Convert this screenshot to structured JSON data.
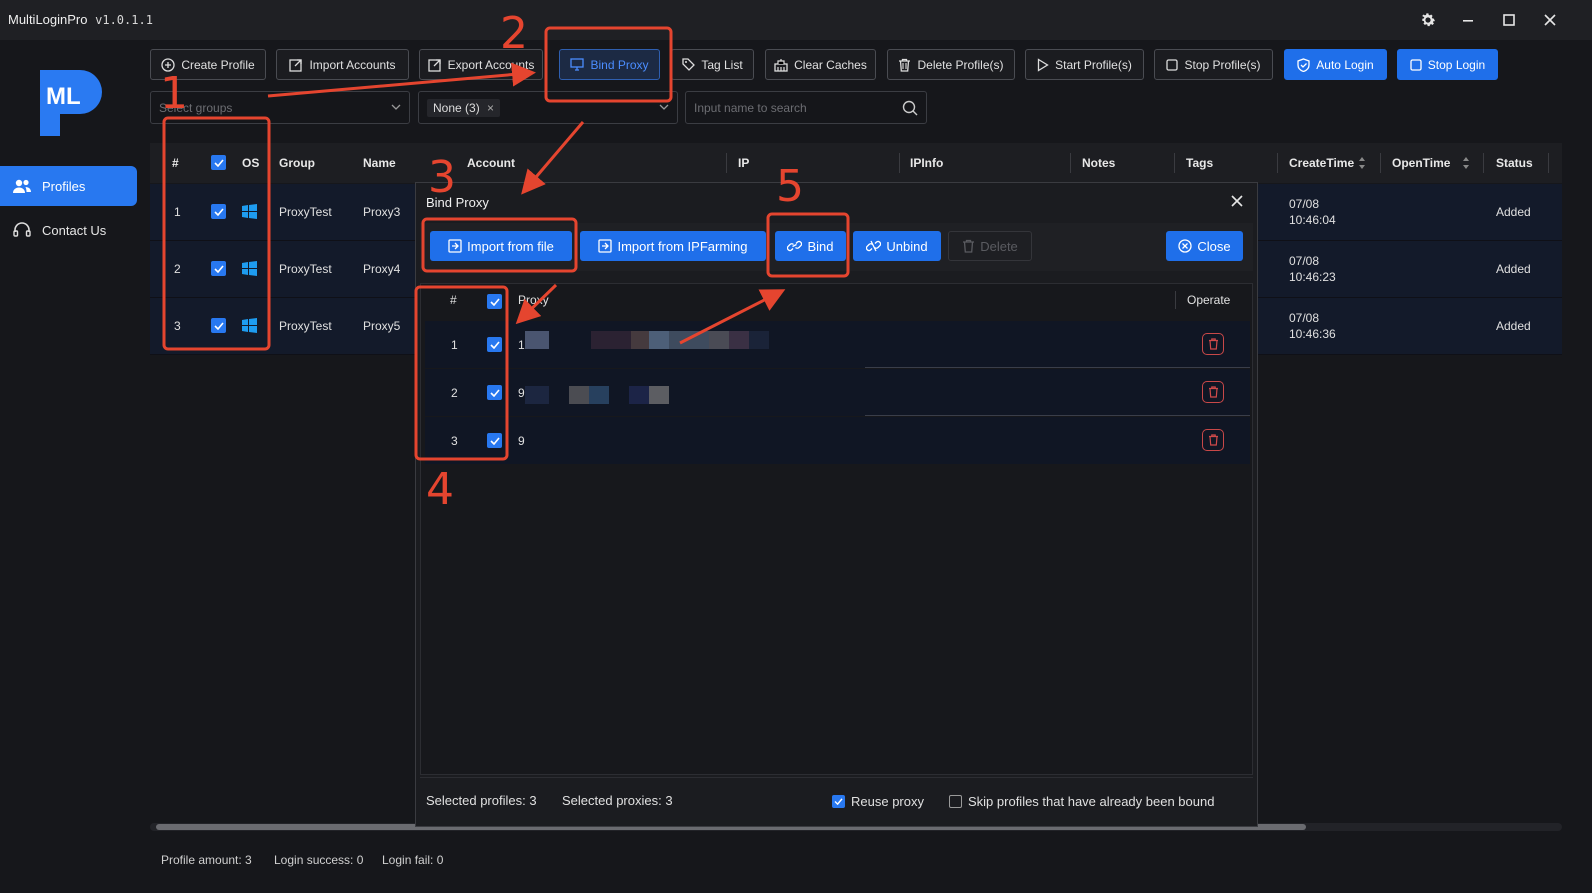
{
  "window": {
    "title": "MultiLoginPro",
    "version": "v1.0.1.1"
  },
  "sidebar": {
    "logo_text": "ML",
    "items": [
      {
        "label": "Profiles",
        "icon": "users-icon",
        "active": true
      },
      {
        "label": "Contact Us",
        "icon": "headset-icon",
        "active": false
      }
    ]
  },
  "toolbar": {
    "buttons": [
      {
        "label": "Create Profile",
        "icon": "plus-circle-icon"
      },
      {
        "label": "Import Accounts",
        "icon": "import-icon"
      },
      {
        "label": "Export Accounts",
        "icon": "export-icon"
      },
      {
        "label": "Bind Proxy",
        "icon": "monitor-icon"
      },
      {
        "label": "Tag List",
        "icon": "tag-icon"
      },
      {
        "label": "Clear Caches",
        "icon": "broom-icon"
      },
      {
        "label": "Delete Profile(s)",
        "icon": "trash-icon"
      },
      {
        "label": "Start Profile(s)",
        "icon": "play-icon"
      },
      {
        "label": "Stop Profile(s)",
        "icon": "stop-icon"
      },
      {
        "label": "Auto Login",
        "icon": "shield-icon"
      },
      {
        "label": "Stop Login",
        "icon": "stop-icon"
      }
    ]
  },
  "filters": {
    "groups_placeholder": "Select groups",
    "tag_filter_value": "None (3)",
    "search_placeholder": "Input name to search"
  },
  "table": {
    "columns": [
      "#",
      "OS",
      "Group",
      "Name",
      "Account",
      "IP",
      "IPInfo",
      "Notes",
      "Tags",
      "CreateTime",
      "OpenTime",
      "Status"
    ],
    "rows": [
      {
        "index": "1",
        "group": "ProxyTest",
        "name": "Proxy3",
        "create_date": "07/08",
        "create_time": "10:46:04",
        "status": "Added"
      },
      {
        "index": "2",
        "group": "ProxyTest",
        "name": "Proxy4",
        "create_date": "07/08",
        "create_time": "10:46:23",
        "status": "Added"
      },
      {
        "index": "3",
        "group": "ProxyTest",
        "name": "Proxy5",
        "create_date": "07/08",
        "create_time": "10:46:36",
        "status": "Added"
      }
    ]
  },
  "footer": {
    "profile_amount": "Profile amount: 3",
    "login_success": "Login success: 0",
    "login_fail": "Login fail: 0"
  },
  "dialog": {
    "title": "Bind Proxy",
    "buttons": {
      "import_file": "Import from file",
      "import_ipfarming": "Import from IPFarming",
      "bind": "Bind",
      "unbind": "Unbind",
      "delete": "Delete",
      "close": "Close"
    },
    "columns": {
      "index": "#",
      "proxy": "Proxy",
      "operate": "Operate"
    },
    "rows": [
      {
        "index": "1",
        "proxy_prefix": "1"
      },
      {
        "index": "2",
        "proxy_prefix": "9"
      },
      {
        "index": "3",
        "proxy_prefix": "9"
      }
    ],
    "selected_profiles": "Selected profiles: 3",
    "selected_proxies": "Selected proxies: 3",
    "reuse_proxy_label": "Reuse proxy",
    "reuse_proxy_checked": true,
    "skip_bound_label": "Skip profiles that have already been bound",
    "skip_bound_checked": false
  },
  "annotations": {
    "steps": [
      "1",
      "2",
      "3",
      "4",
      "5"
    ],
    "color": "#e5452f"
  },
  "colors": {
    "accent": "#1f6fea",
    "background": "#16171b",
    "annotation": "#e5452f"
  }
}
